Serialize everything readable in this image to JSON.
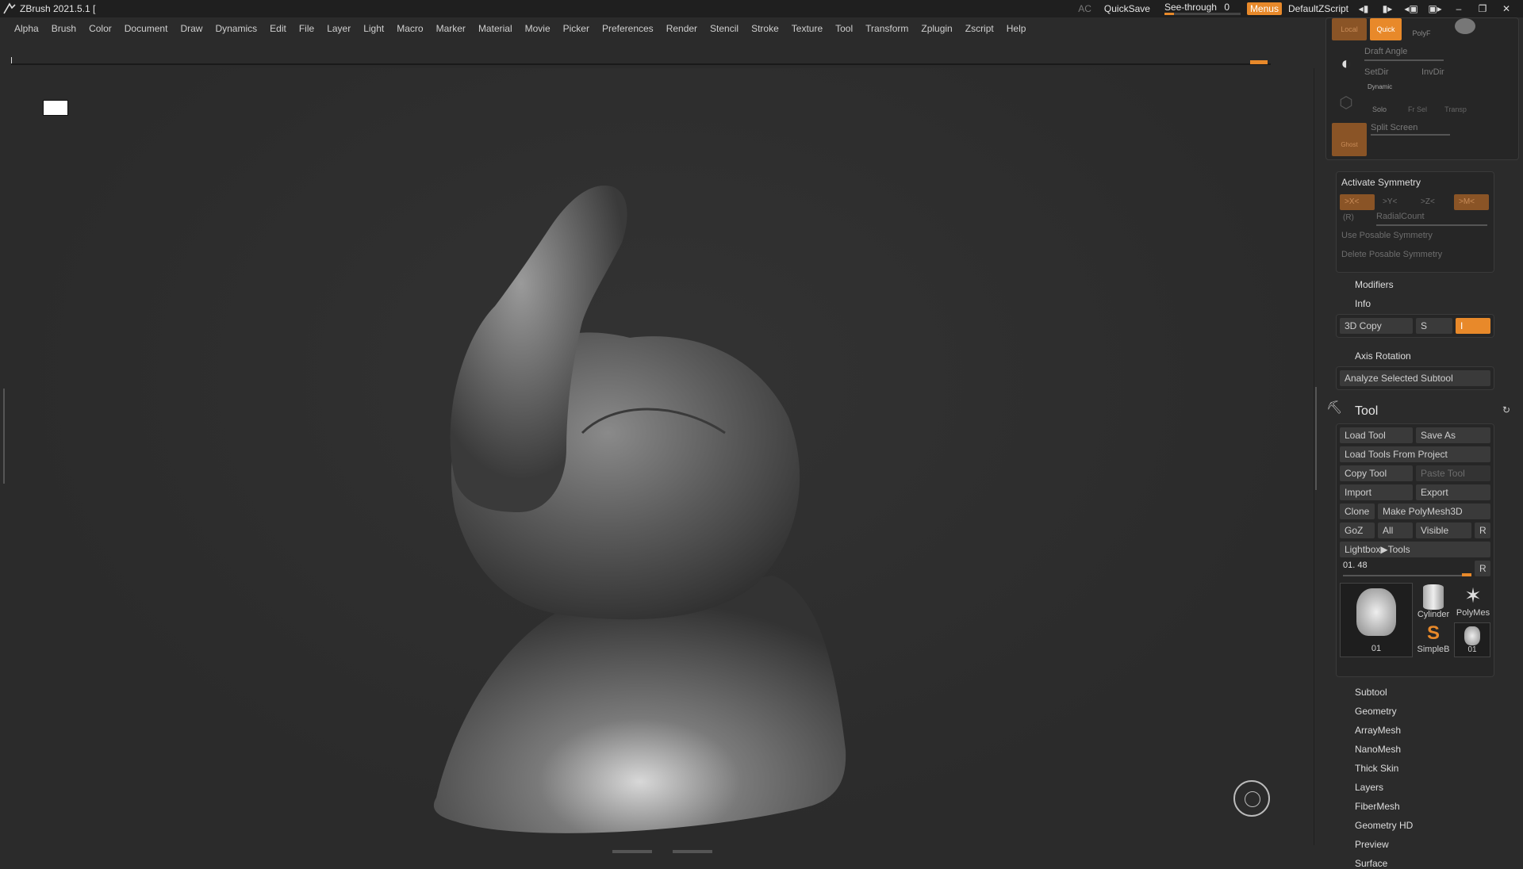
{
  "titlebar": {
    "title": "ZBrush 2021.5.1 [",
    "ac": "AC",
    "quicksave": "QuickSave",
    "see_through_label": "See-through",
    "see_through_value": "0",
    "see_through_fraction": 0.0,
    "menus": "Menus",
    "default_zscript": "DefaultZScript"
  },
  "menubar": [
    "Alpha",
    "Brush",
    "Color",
    "Document",
    "Draw",
    "Dynamics",
    "Edit",
    "File",
    "Layer",
    "Light",
    "Macro",
    "Marker",
    "Material",
    "Movie",
    "Picker",
    "Preferences",
    "Render",
    "Stencil",
    "Stroke",
    "Texture",
    "Tool",
    "Transform",
    "Zplugin",
    "Zscript",
    "Help"
  ],
  "colors": {
    "accent": "#e8892a",
    "bg": "#2b2b2b",
    "panel": "#262626",
    "button": "#3a3a3a"
  },
  "right_panel": {
    "top": {
      "local": "Local",
      "quick": "Quick",
      "polyf": "PolyF",
      "draft_angle": "Draft Angle",
      "setdir": "SetDir",
      "invdir": "InvDir",
      "dynamic": "Dynamic",
      "solo": "Solo",
      "frsel": "Fr Sel",
      "transp": "Transp",
      "ghost": "Ghost",
      "split_screen": "Split Screen"
    },
    "symmetry": {
      "activate": "Activate Symmetry",
      "x": ">X<",
      "y": ">Y<",
      "z": ">Z<",
      "m": ">M<",
      "r": "(R)",
      "radial_count": "RadialCount",
      "use_posable": "Use Posable Symmetry",
      "delete_posable": "Delete Posable Symmetry"
    },
    "modifiers": "Modifiers",
    "info": "Info",
    "copy3d": {
      "label": "3D Copy",
      "s": "S",
      "i": "I"
    },
    "axis_rotation": "Axis Rotation",
    "analyze": "Analyze Selected Subtool",
    "tool": {
      "title": "Tool",
      "load_tool": "Load Tool",
      "save_as": "Save As",
      "load_from_project": "Load Tools From Project",
      "copy_tool": "Copy Tool",
      "paste_tool": "Paste Tool",
      "import": "Import",
      "export": "Export",
      "clone": "Clone",
      "make_polymesh": "Make PolyMesh3D",
      "goz": "GoZ",
      "all": "All",
      "visible": "Visible",
      "r": "R",
      "lightbox_tools": "Lightbox▶Tools",
      "slider_value": "01. 48",
      "slider_fraction": 0.93,
      "slider_r": "R",
      "thumbs": {
        "main": "01",
        "cylinder": "Cylinder",
        "polymesh": "PolyMes",
        "simpleb": "SimpleB",
        "small01": "01"
      }
    },
    "subpalettes": [
      "Subtool",
      "Geometry",
      "ArrayMesh",
      "NanoMesh",
      "Thick Skin",
      "Layers",
      "FiberMesh",
      "Geometry HD",
      "Preview",
      "Surface"
    ]
  }
}
